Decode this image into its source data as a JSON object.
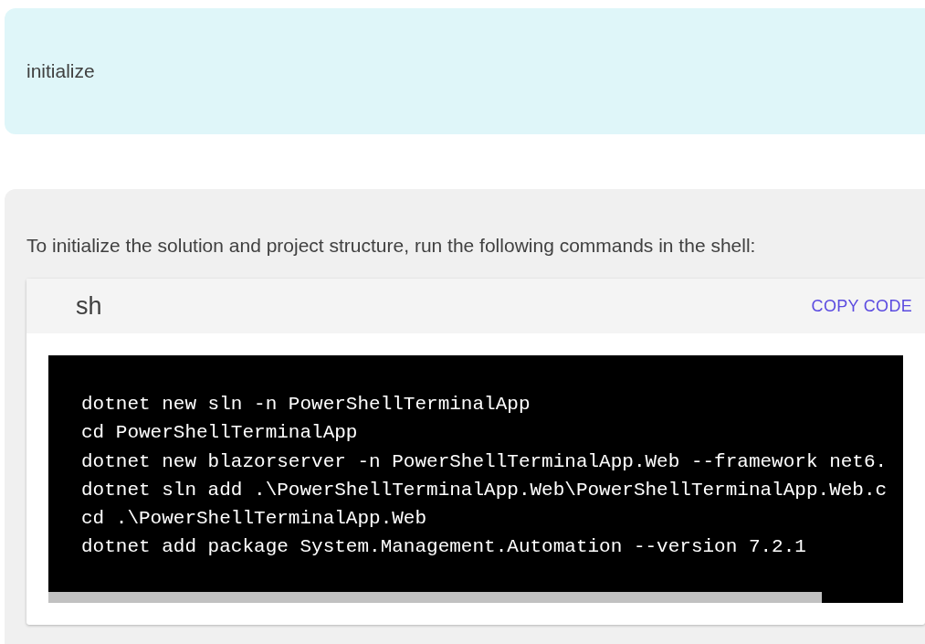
{
  "prompt": {
    "text": "initialize"
  },
  "answer": {
    "intro": "To initialize the solution and project structure, run the following commands in the shell:",
    "code_block": {
      "language": "sh",
      "copy_button": "COPY CODE",
      "lines": [
        "dotnet new sln -n PowerShellTerminalApp",
        "cd PowerShellTerminalApp",
        "dotnet new blazorserver -n PowerShellTerminalApp.Web --framework net6.",
        "dotnet sln add .\\PowerShellTerminalApp.Web\\PowerShellTerminalApp.Web.c",
        "cd .\\PowerShellTerminalApp.Web",
        "dotnet add package System.Management.Automation --version 7.2.1"
      ]
    }
  }
}
